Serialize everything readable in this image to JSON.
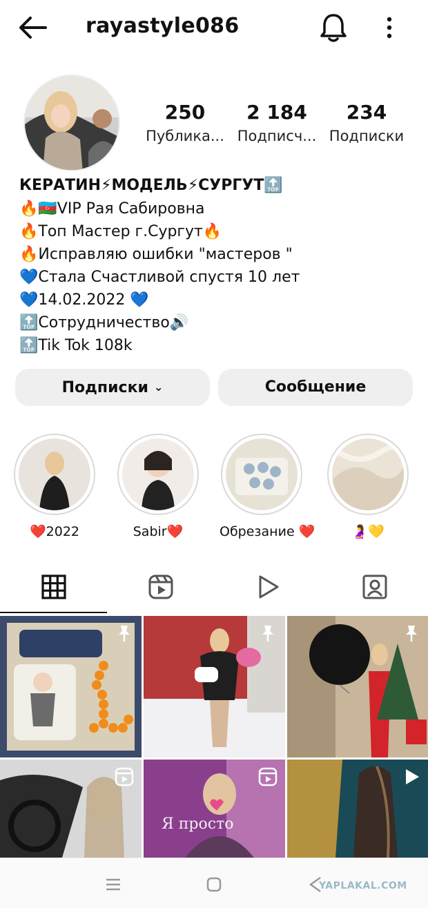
{
  "header": {
    "username": "rayastyle086"
  },
  "stats": [
    {
      "value": "250",
      "label": "Публика..."
    },
    {
      "value": "2 184",
      "label": "Подписч..."
    },
    {
      "value": "234",
      "label": "Подписки"
    }
  ],
  "bio": {
    "title": "КЕРАТИН⚡МОДЕЛЬ⚡СУРГУТ🔝",
    "lines": [
      "🔥🇦🇿VIP Рая Сабировна",
      "🔥Топ Мастер г.Сургут🔥",
      "🔥Исправляю ошибки \"мастеров \"",
      "💙Стала Счастливой спустя 10 лет",
      "💙14.02.2022 💙",
      "🔝Сотрудничество🔊",
      "🔝Tik Tok 108k"
    ]
  },
  "buttons": {
    "following": "Подписки",
    "message": "Сообщение"
  },
  "highlights": [
    {
      "label": "❤️2022"
    },
    {
      "label": "Sabir❤️"
    },
    {
      "label": "Обрезание ❤️"
    },
    {
      "label": "🤰💛"
    }
  ],
  "tabs": [
    "grid",
    "reels",
    "videos",
    "tagged"
  ],
  "watermark": "YAPLAKAL.COM"
}
